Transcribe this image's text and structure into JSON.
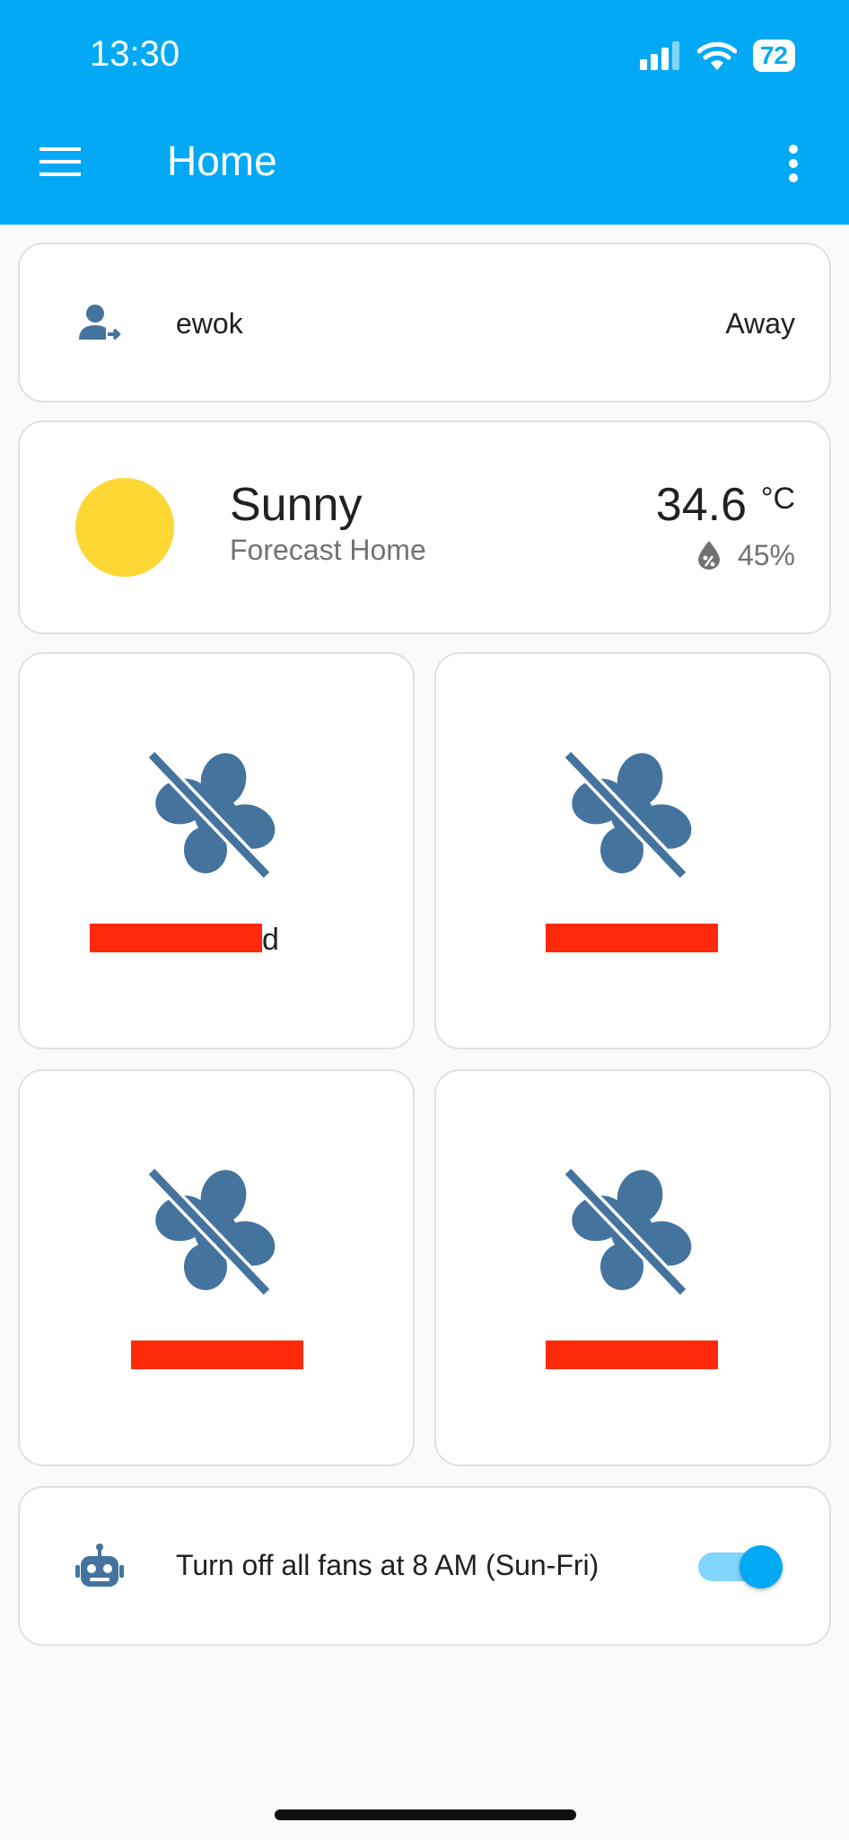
{
  "status_bar": {
    "time": "13:30",
    "battery": "72"
  },
  "app_bar": {
    "title": "Home"
  },
  "person": {
    "name": "ewok",
    "state": "Away"
  },
  "weather": {
    "condition": "Sunny",
    "subtitle": "Forecast Home",
    "temperature": "34.6",
    "unit": "°C",
    "humidity": "45%"
  },
  "fans": [
    {
      "label_visible": "d"
    },
    {
      "label_visible": ""
    },
    {
      "label_visible": ""
    },
    {
      "label_visible": ""
    }
  ],
  "automation": {
    "label": "Turn off all fans at 8 AM (Sun-Fri)",
    "enabled": true
  },
  "colors": {
    "header": "#03a9f4",
    "icon": "#44739e",
    "sun": "#fdd835",
    "redaction": "#ff2a0a"
  }
}
